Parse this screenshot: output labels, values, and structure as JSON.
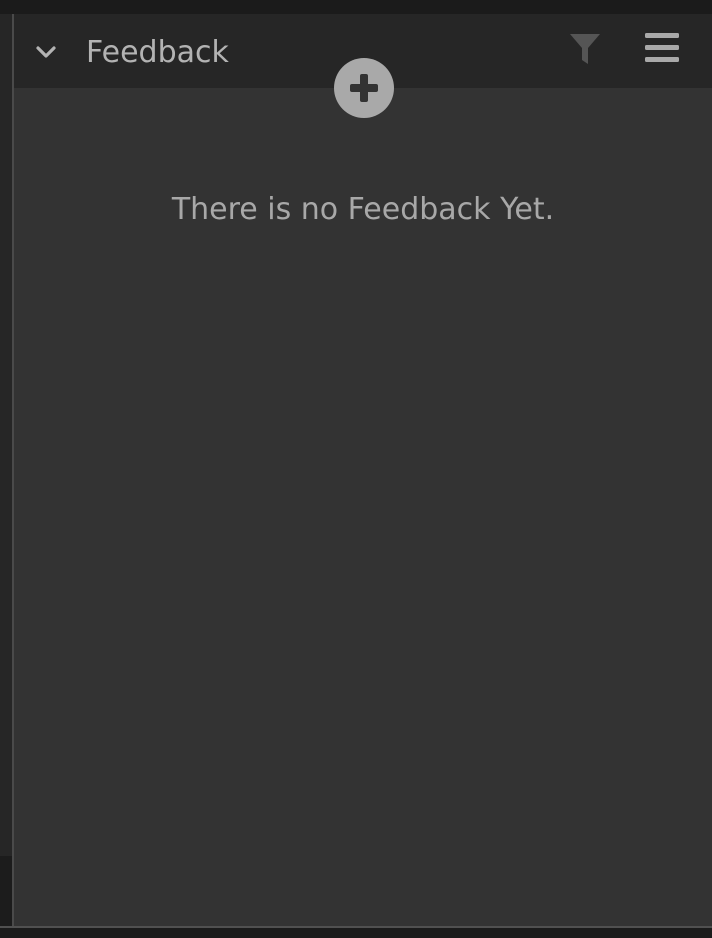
{
  "panel": {
    "title": "Feedback",
    "empty_message": "There is no Feedback Yet."
  },
  "icons": {
    "collapse": "chevron-down-icon",
    "filter": "filter-icon",
    "menu": "hamburger-menu-icon",
    "add": "plus-circle-icon"
  },
  "colors": {
    "panel_background": "#333333",
    "header_background": "#262626",
    "text": "#b3b3b3",
    "add_button": "#a9a9a9"
  }
}
